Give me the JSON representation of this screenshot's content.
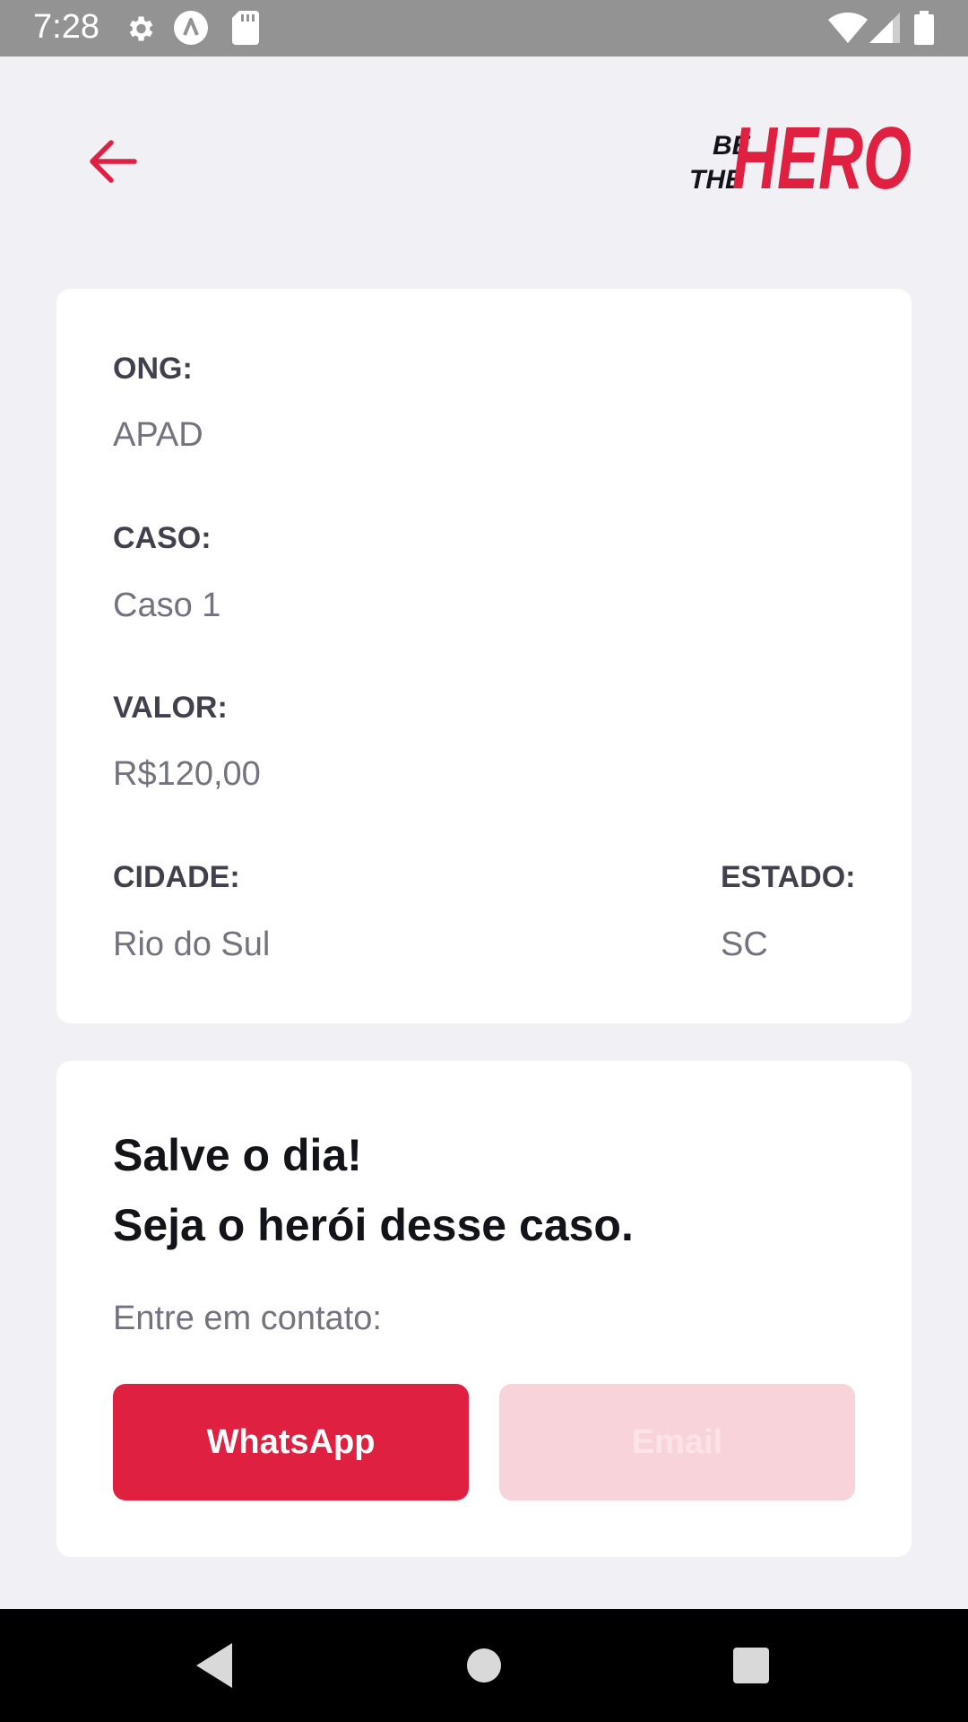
{
  "status_bar": {
    "time": "7:28",
    "icons": [
      "settings-gear-icon",
      "app-notification-icon",
      "sd-card-icon",
      "wifi-icon",
      "cellular-signal-icon",
      "battery-icon"
    ]
  },
  "header": {
    "back_icon": "arrow-left-icon",
    "logo": {
      "line1": "BE",
      "line2": "THE",
      "word": "HERO"
    }
  },
  "incident": {
    "ong_label": "ONG:",
    "ong_value": "APAD",
    "caso_label": "CASO:",
    "caso_value": "Caso 1",
    "valor_label": "VALOR:",
    "valor_value": "R$120,00",
    "cidade_label": "CIDADE:",
    "cidade_value": "Rio do Sul",
    "estado_label": "ESTADO:",
    "estado_value": "SC"
  },
  "contact": {
    "title_line1": "Salve o dia!",
    "title_line2": "Seja o herói desse caso.",
    "subtitle": "Entre em contato:",
    "whatsapp_label": "WhatsApp",
    "email_label": "Email"
  },
  "nav_bar": {
    "icons": [
      "back-triangle-icon",
      "home-circle-icon",
      "recents-square-icon"
    ]
  },
  "colors": {
    "accent": "#e02041",
    "background": "#f0f0f5",
    "card": "#ffffff",
    "label": "#41414d",
    "value": "#737380",
    "email_button_disabled": "#f8d3da"
  }
}
